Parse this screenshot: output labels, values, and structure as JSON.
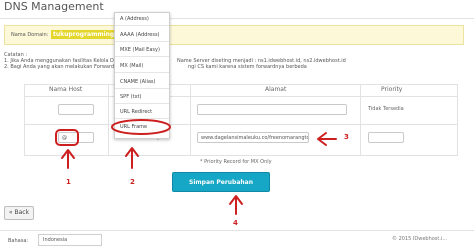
{
  "page": {
    "title": "DNS Management"
  },
  "domain": {
    "label": "Nama Domain:",
    "value": "tukuprogrammingcourse.com"
  },
  "notes": {
    "heading": "Catatan :",
    "line1_start": "1. Jika Anda menggunakan fasilitas Kelola DN",
    "line1_end": "Name Server diseting menjadi : ns1.idwebhost.id, ns2.idwebhost.id",
    "line2_start": "2. Bagi Anda yang akan melakukan Forward",
    "line2_end": "ngi CS kami karena sistem forwardnya berbeda"
  },
  "table": {
    "headers": {
      "host": "Nama Host",
      "address": "Alamat",
      "priority": "Priority"
    },
    "row1": {
      "priority_value": "Tidak Tersedia"
    },
    "row2": {
      "host_value": "@",
      "record_type": "A (Address)",
      "address_value": "www.dagelansimaleuku.co/freenomarangtonggo"
    }
  },
  "dropdown": {
    "options": [
      "A (Address)",
      "AAAA (Address)",
      "MXE (Mail Easy)",
      "MX (Mail)",
      "CNAME (Alias)",
      "SPF (txt)",
      "URL Redirect",
      "URL Frame"
    ]
  },
  "priority_note": "* Priority Record for MX Only",
  "buttons": {
    "save": "Simpan Perubahan",
    "back": "« Back"
  },
  "footer": {
    "language_label": "Bahasa:",
    "language_value": "Indonesia",
    "copyright": "© 2015 IDwebhost.i..."
  },
  "annotations": {
    "n1": "1",
    "n2": "2",
    "n3": "3",
    "n4": "4",
    "color": "#cc1f1f"
  }
}
